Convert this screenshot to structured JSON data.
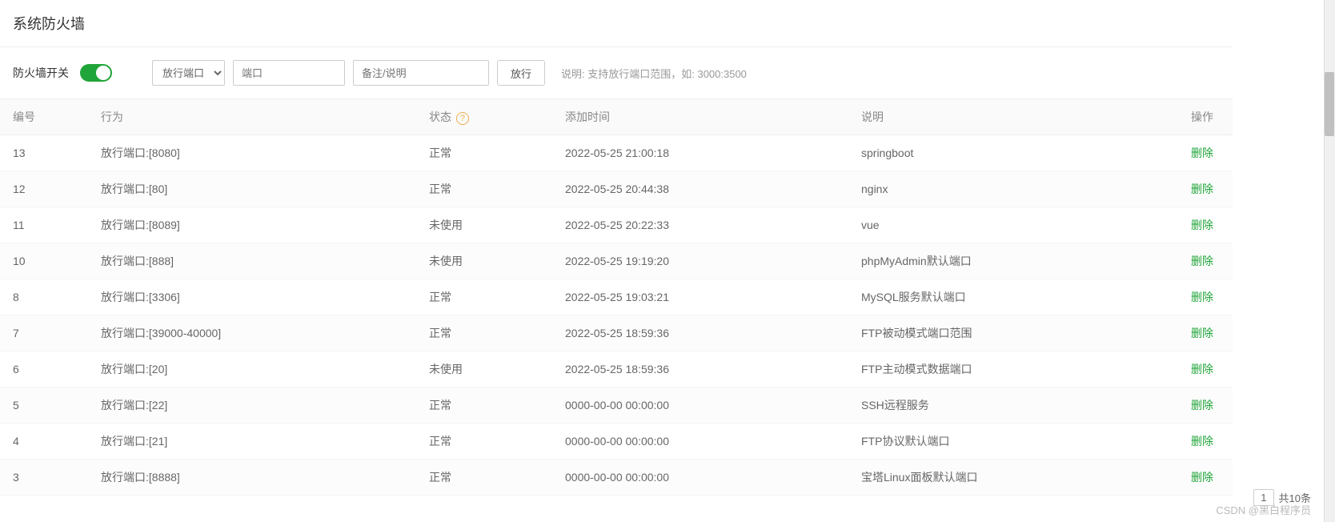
{
  "header": {
    "title": "系统防火墙"
  },
  "toolbar": {
    "switch_label": "防火墙开关",
    "select_value": "放行端口",
    "port_placeholder": "端口",
    "remark_placeholder": "备注/说明",
    "submit_label": "放行",
    "hint": "说明: 支持放行端口范围，如: 3000:3500"
  },
  "table": {
    "headers": {
      "id": "编号",
      "behavior": "行为",
      "status": "状态",
      "time": "添加时间",
      "desc": "说明",
      "op": "操作"
    },
    "delete_label": "删除",
    "rows": [
      {
        "id": "13",
        "behavior": "放行端口:[8080]",
        "status": "正常",
        "time": "2022-05-25 21:00:18",
        "desc": "springboot"
      },
      {
        "id": "12",
        "behavior": "放行端口:[80]",
        "status": "正常",
        "time": "2022-05-25 20:44:38",
        "desc": "nginx"
      },
      {
        "id": "11",
        "behavior": "放行端口:[8089]",
        "status": "未使用",
        "time": "2022-05-25 20:22:33",
        "desc": "vue"
      },
      {
        "id": "10",
        "behavior": "放行端口:[888]",
        "status": "未使用",
        "time": "2022-05-25 19:19:20",
        "desc": "phpMyAdmin默认端口"
      },
      {
        "id": "8",
        "behavior": "放行端口:[3306]",
        "status": "正常",
        "time": "2022-05-25 19:03:21",
        "desc": "MySQL服务默认端口"
      },
      {
        "id": "7",
        "behavior": "放行端口:[39000-40000]",
        "status": "正常",
        "time": "2022-05-25 18:59:36",
        "desc": "FTP被动模式端口范围"
      },
      {
        "id": "6",
        "behavior": "放行端口:[20]",
        "status": "未使用",
        "time": "2022-05-25 18:59:36",
        "desc": "FTP主动模式数据端口"
      },
      {
        "id": "5",
        "behavior": "放行端口:[22]",
        "status": "正常",
        "time": "0000-00-00 00:00:00",
        "desc": "SSH远程服务"
      },
      {
        "id": "4",
        "behavior": "放行端口:[21]",
        "status": "正常",
        "time": "0000-00-00 00:00:00",
        "desc": "FTP协议默认端口"
      },
      {
        "id": "3",
        "behavior": "放行端口:[8888]",
        "status": "正常",
        "time": "0000-00-00 00:00:00",
        "desc": "宝塔Linux面板默认端口"
      }
    ]
  },
  "pagination": {
    "page": "1",
    "total_label": "共10条"
  },
  "watermark": "CSDN @黑白程序员"
}
